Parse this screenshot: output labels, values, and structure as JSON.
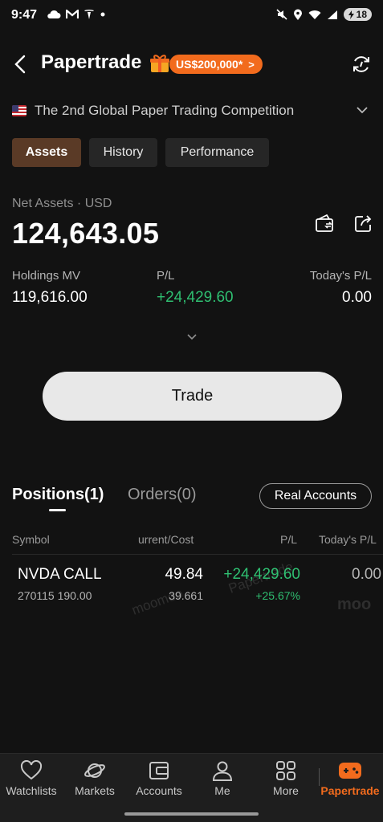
{
  "status_bar": {
    "time": "9:47",
    "battery": "18",
    "icons_left": [
      "cloud-icon",
      "gmail-icon",
      "tesla-icon",
      "dot-icon"
    ],
    "icons_right": [
      "mute-icon",
      "location-icon",
      "wifi-icon",
      "signal-icon",
      "battery-icon"
    ]
  },
  "header": {
    "title": "Papertrade",
    "promo": "US$200,000*",
    "promo_arrow": ">",
    "competition": "The 2nd Global Paper Trading Competition"
  },
  "tabs": [
    {
      "label": "Assets",
      "active": true
    },
    {
      "label": "History",
      "active": false
    },
    {
      "label": "Performance",
      "active": false
    }
  ],
  "summary": {
    "net_label": "Net Assets · USD",
    "net_value": "124,643.05",
    "holdings_label": "Holdings MV",
    "holdings_value": "119,616.00",
    "pl_label": "P/L",
    "pl_value": "+24,429.60",
    "today_label": "Today's P/L",
    "today_value": "0.00"
  },
  "trade_button": "Trade",
  "positions": {
    "tab_positions": "Positions(1)",
    "tab_orders": "Orders(0)",
    "real_accounts": "Real Accounts",
    "headers": {
      "symbol": "Symbol",
      "current_cost": "urrent/Cost",
      "pl": "P/L",
      "today_pl": "Today's P/L"
    },
    "rows": [
      {
        "symbol": "NVDA CALL",
        "sub": "270115 190.00",
        "current": "49.84",
        "cost": "39.661",
        "pl": "+24,429.60",
        "pl_pct": "+25.67%",
        "today_pl": "0.00"
      }
    ],
    "watermarks": [
      "Papertrade",
      "moomoo",
      "moo"
    ]
  },
  "nav": [
    {
      "label": "Watchlists",
      "icon": "heart-icon"
    },
    {
      "label": "Markets",
      "icon": "planet-icon"
    },
    {
      "label": "Accounts",
      "icon": "wallet-icon"
    },
    {
      "label": "Me",
      "icon": "person-icon"
    },
    {
      "label": "More",
      "icon": "grid-icon"
    },
    {
      "label": "Papertrade",
      "icon": "gamepad-icon",
      "active": true
    }
  ],
  "colors": {
    "background": "#121212",
    "accent": "#f26b1d",
    "positive": "#2fbf71",
    "active_tab": "#5a3a26"
  }
}
